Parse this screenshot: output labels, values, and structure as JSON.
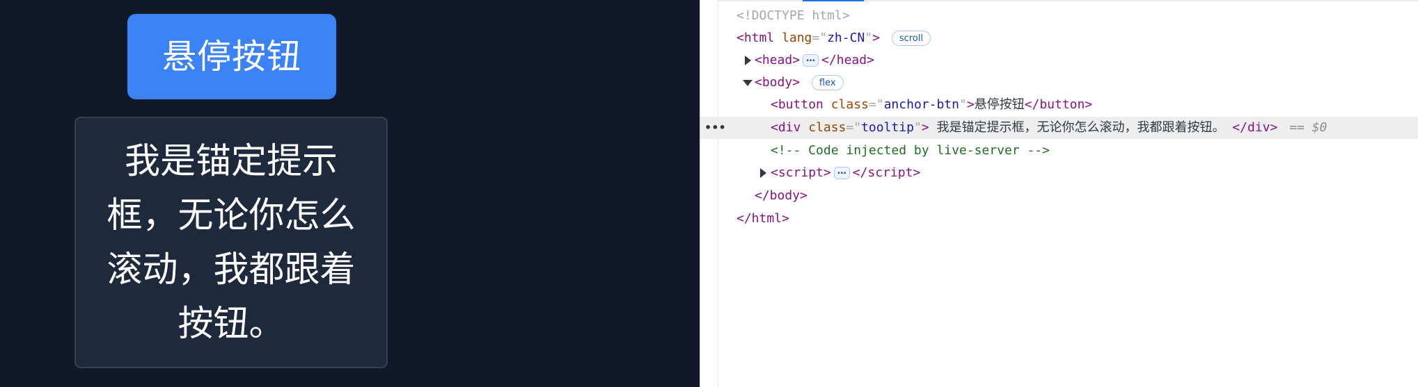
{
  "preview": {
    "button_label": "悬停按钮",
    "tooltip_lines": [
      "我是锚定提示",
      "框，无论你怎么",
      "滚动，我都跟着",
      "按钮。"
    ]
  },
  "devtools": {
    "doctype": "<!DOCTYPE html>",
    "html_open": {
      "tag": "html",
      "attr": "lang",
      "value": "zh-CN",
      "badge": "scroll"
    },
    "head": {
      "open": "head",
      "ellipsis": "…",
      "close": "/head"
    },
    "body_open": {
      "tag": "body",
      "badge": "flex"
    },
    "button_line": {
      "tag": "button",
      "attr": "class",
      "value": "anchor-btn",
      "text": "悬停按钮",
      "close": "/button"
    },
    "tooltip_line": {
      "tag": "div",
      "attr": "class",
      "value": "tooltip",
      "text": " 我是锚定提示框，无论你怎么滚动，我都跟着按钮。 ",
      "close": "/div",
      "selected_marker": "== $0",
      "row_dots": "•••"
    },
    "comment_line": "<!-- Code injected by live-server -->",
    "script": {
      "open": "script",
      "ellipsis": "…",
      "close": "/script"
    },
    "body_close": "</body>",
    "html_close": "</html>"
  },
  "colors": {
    "page_bg": "#111827",
    "button_bg": "#3b82f6",
    "tooltip_bg": "#1e293b",
    "tooltip_border": "#334155"
  }
}
